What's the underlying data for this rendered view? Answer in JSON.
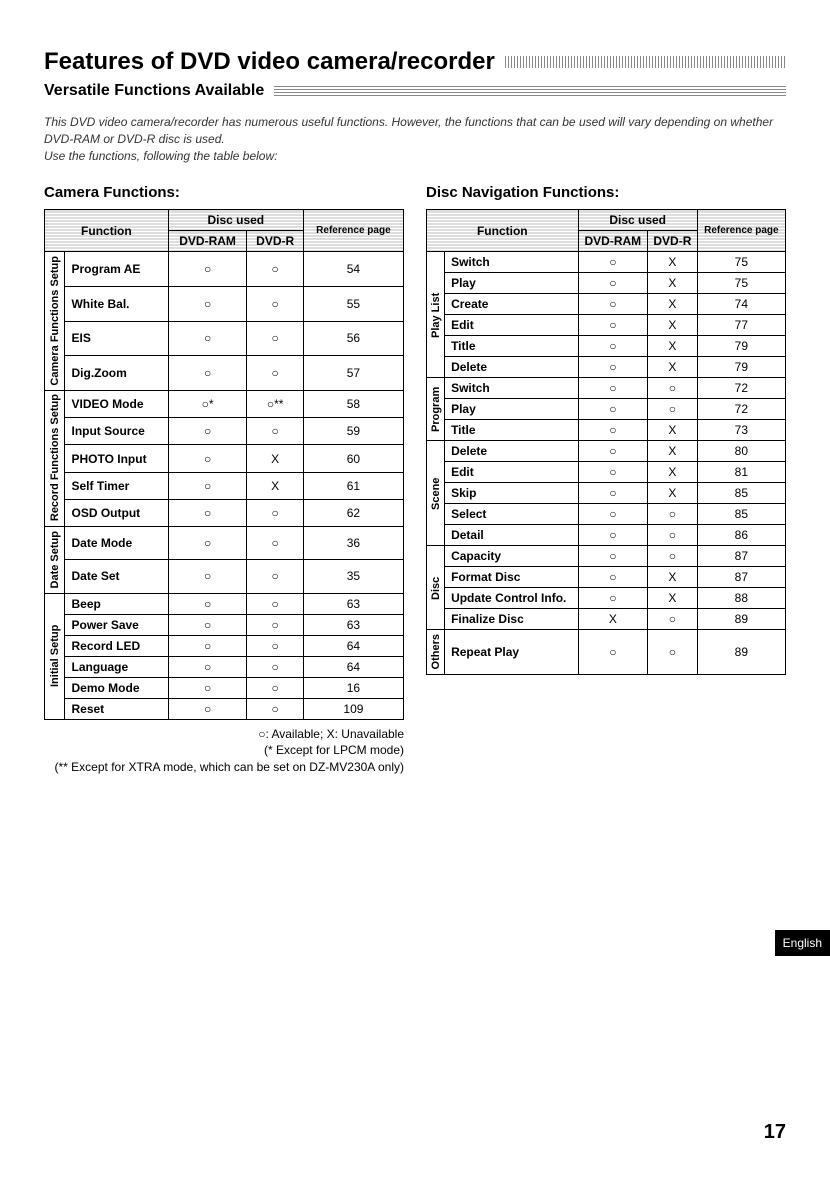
{
  "title": "Features of DVD video camera/recorder",
  "subtitle": "Versatile Functions Available",
  "intro": "This DVD video camera/recorder has numerous useful functions. However, the functions that can be used will vary depending on whether DVD-RAM or DVD-R disc is used.\nUse the functions, following the table below:",
  "symbols": {
    "avail": "○",
    "unavail": "X",
    "avail_star": "○*",
    "avail_dstar": "○**"
  },
  "camera": {
    "heading": "Camera Functions:",
    "headers": {
      "function": "Function",
      "disc_used": "Disc used",
      "dvdram": "DVD-RAM",
      "dvdr": "DVD-R",
      "ref": "Reference page"
    },
    "groups": [
      {
        "name": "Camera Functions Setup",
        "rows": [
          {
            "fn": "Program AE",
            "ram": "○",
            "r": "○",
            "page": "54"
          },
          {
            "fn": "White Bal.",
            "ram": "○",
            "r": "○",
            "page": "55"
          },
          {
            "fn": "EIS",
            "ram": "○",
            "r": "○",
            "page": "56"
          },
          {
            "fn": "Dig.Zoom",
            "ram": "○",
            "r": "○",
            "page": "57"
          }
        ]
      },
      {
        "name": "Record Functions Setup",
        "rows": [
          {
            "fn": "VIDEO Mode",
            "ram": "○*",
            "r": "○**",
            "page": "58"
          },
          {
            "fn": "Input Source",
            "ram": "○",
            "r": "○",
            "page": "59"
          },
          {
            "fn": "PHOTO Input",
            "ram": "○",
            "r": "X",
            "page": "60"
          },
          {
            "fn": "Self Timer",
            "ram": "○",
            "r": "X",
            "page": "61"
          },
          {
            "fn": "OSD Output",
            "ram": "○",
            "r": "○",
            "page": "62"
          }
        ]
      },
      {
        "name": "Date Setup",
        "rows": [
          {
            "fn": "Date Mode",
            "ram": "○",
            "r": "○",
            "page": "36"
          },
          {
            "fn": "Date Set",
            "ram": "○",
            "r": "○",
            "page": "35"
          }
        ]
      },
      {
        "name": "Initial Setup",
        "rows": [
          {
            "fn": "Beep",
            "ram": "○",
            "r": "○",
            "page": "63"
          },
          {
            "fn": "Power Save",
            "ram": "○",
            "r": "○",
            "page": "63"
          },
          {
            "fn": "Record LED",
            "ram": "○",
            "r": "○",
            "page": "64"
          },
          {
            "fn": "Language",
            "ram": "○",
            "r": "○",
            "page": "64"
          },
          {
            "fn": "Demo Mode",
            "ram": "○",
            "r": "○",
            "page": "16"
          },
          {
            "fn": "Reset",
            "ram": "○",
            "r": "○",
            "page": "109"
          }
        ]
      }
    ],
    "legend": "○: Available; X: Unavailable\n(* Except for LPCM mode)\n(** Except for XTRA mode, which can be set on DZ-MV230A only)"
  },
  "nav": {
    "heading": "Disc Navigation Functions:",
    "headers": {
      "function": "Function",
      "disc_used": "Disc used",
      "dvdram": "DVD-RAM",
      "dvdr": "DVD-R",
      "ref": "Reference page"
    },
    "groups": [
      {
        "name": "Play List",
        "rows": [
          {
            "fn": "Switch",
            "ram": "○",
            "r": "X",
            "page": "75"
          },
          {
            "fn": "Play",
            "ram": "○",
            "r": "X",
            "page": "75"
          },
          {
            "fn": "Create",
            "ram": "○",
            "r": "X",
            "page": "74"
          },
          {
            "fn": "Edit",
            "ram": "○",
            "r": "X",
            "page": "77"
          },
          {
            "fn": "Title",
            "ram": "○",
            "r": "X",
            "page": "79"
          },
          {
            "fn": "Delete",
            "ram": "○",
            "r": "X",
            "page": "79"
          }
        ]
      },
      {
        "name": "Program",
        "rows": [
          {
            "fn": "Switch",
            "ram": "○",
            "r": "○",
            "page": "72"
          },
          {
            "fn": "Play",
            "ram": "○",
            "r": "○",
            "page": "72"
          },
          {
            "fn": "Title",
            "ram": "○",
            "r": "X",
            "page": "73"
          }
        ]
      },
      {
        "name": "Scene",
        "rows": [
          {
            "fn": "Delete",
            "ram": "○",
            "r": "X",
            "page": "80"
          },
          {
            "fn": "Edit",
            "ram": "○",
            "r": "X",
            "page": "81"
          },
          {
            "fn": "Skip",
            "ram": "○",
            "r": "X",
            "page": "85"
          },
          {
            "fn": "Select",
            "ram": "○",
            "r": "○",
            "page": "85"
          },
          {
            "fn": "Detail",
            "ram": "○",
            "r": "○",
            "page": "86"
          }
        ]
      },
      {
        "name": "Disc",
        "rows": [
          {
            "fn": "Capacity",
            "ram": "○",
            "r": "○",
            "page": "87"
          },
          {
            "fn": "Format Disc",
            "ram": "○",
            "r": "X",
            "page": "87"
          },
          {
            "fn": "Update Control Info.",
            "ram": "○",
            "r": "X",
            "page": "88"
          },
          {
            "fn": "Finalize Disc",
            "ram": "X",
            "r": "○",
            "page": "89"
          }
        ]
      },
      {
        "name": "Others",
        "rows": [
          {
            "fn": "Repeat Play",
            "ram": "○",
            "r": "○",
            "page": "89"
          }
        ]
      }
    ]
  },
  "tab": "English",
  "pagenum": "17"
}
